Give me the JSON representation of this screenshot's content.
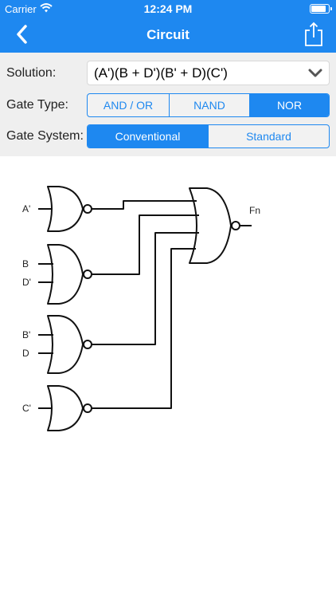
{
  "status": {
    "carrier": "Carrier",
    "time": "12:24 PM",
    "battery_level": 0.9
  },
  "nav": {
    "title": "Circuit",
    "back_icon": "chevron-left-icon",
    "share_icon": "share-icon"
  },
  "settings": {
    "solution_label": "Solution:",
    "solution_value": "(A')(B + D')(B' + D)(C')",
    "gate_type_label": "Gate Type:",
    "gate_types": [
      "AND / OR",
      "NAND",
      "NOR"
    ],
    "gate_type_selected": "NOR",
    "gate_system_label": "Gate System:",
    "gate_systems": [
      "Conventional",
      "Standard"
    ],
    "gate_system_selected": "Conventional"
  },
  "diagram": {
    "inputs": {
      "a_prime": "A'",
      "b": "B",
      "d_prime": "D'",
      "b_prime": "B'",
      "d": "D",
      "c_prime": "C'"
    },
    "output": "Fn"
  },
  "colors": {
    "accent": "#1e88f0",
    "panel": "#efefef"
  }
}
